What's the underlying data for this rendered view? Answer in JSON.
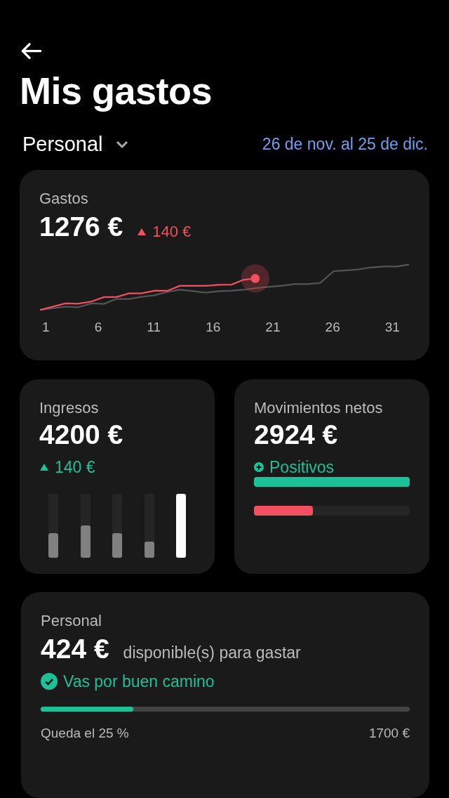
{
  "header": {
    "title": "Mis gastos",
    "account": "Personal",
    "period": "26 de nov. al 25 de dic."
  },
  "expenses": {
    "label": "Gastos",
    "amount": "1276 €",
    "change": "140 €",
    "kind": "increase",
    "x_labels": [
      "1",
      "6",
      "11",
      "16",
      "21",
      "26",
      "31"
    ]
  },
  "income": {
    "label": "Ingresos",
    "amount": "4200 €",
    "change": "140 €",
    "kind": "increase",
    "bars": [
      {
        "level": 0.38,
        "selected": false
      },
      {
        "level": 0.5,
        "selected": false
      },
      {
        "level": 0.38,
        "selected": false
      },
      {
        "level": 0.25,
        "selected": false
      },
      {
        "level": 1,
        "selected": true
      }
    ]
  },
  "net": {
    "label": "Movimientos netos",
    "amount": "2924 €",
    "status": "Positivos",
    "income_bar": {
      "level": 1
    },
    "expense_bar": {
      "level": 0.38
    }
  },
  "budget": {
    "label": "Personal",
    "amount": "424 €",
    "caption": "disponible(s) para gastar",
    "status": "Vas por buen camino",
    "level": 0.25,
    "remaining": "Queda el 25 %",
    "total": "1700 €"
  }
}
